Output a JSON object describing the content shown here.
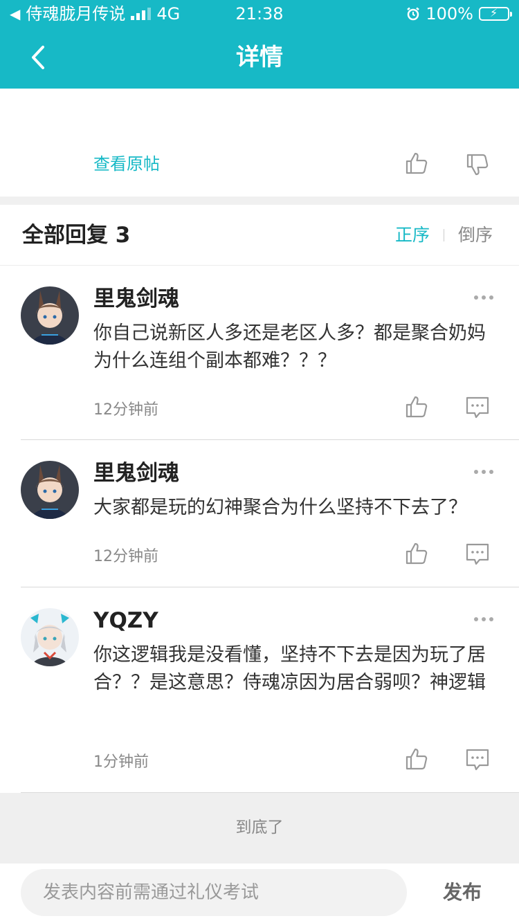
{
  "status_bar": {
    "carrier": "侍魂胧月传说",
    "network": "4G",
    "time": "21:38",
    "battery": "100%"
  },
  "nav": {
    "title": "详情"
  },
  "post": {
    "view_original": "查看原帖"
  },
  "replies": {
    "title": "全部回复 3",
    "sort_asc": "正序",
    "sort_desc": "倒序",
    "items": [
      {
        "name": "里鬼剑魂",
        "content": "你自己说新区人多还是老区人多？都是聚合奶妈为什么连组个副本都难？？？",
        "time": "12分钟前"
      },
      {
        "name": "里鬼剑魂",
        "content": "大家都是玩的幻神聚合为什么坚持不下去了？",
        "time": "12分钟前"
      },
      {
        "name": "YQZY",
        "content": "你这逻辑我是没看懂，坚持不下去是因为玩了居合？？是这意思？侍魂凉因为居合弱呗？神逻辑",
        "time": "1分钟前"
      }
    ]
  },
  "footer": {
    "end_text": "到底了"
  },
  "composer": {
    "placeholder": "发表内容前需通过礼仪考试",
    "send": "发布"
  },
  "colors": {
    "accent": "#17b9c6",
    "text": "#222222",
    "muted": "#888888"
  }
}
